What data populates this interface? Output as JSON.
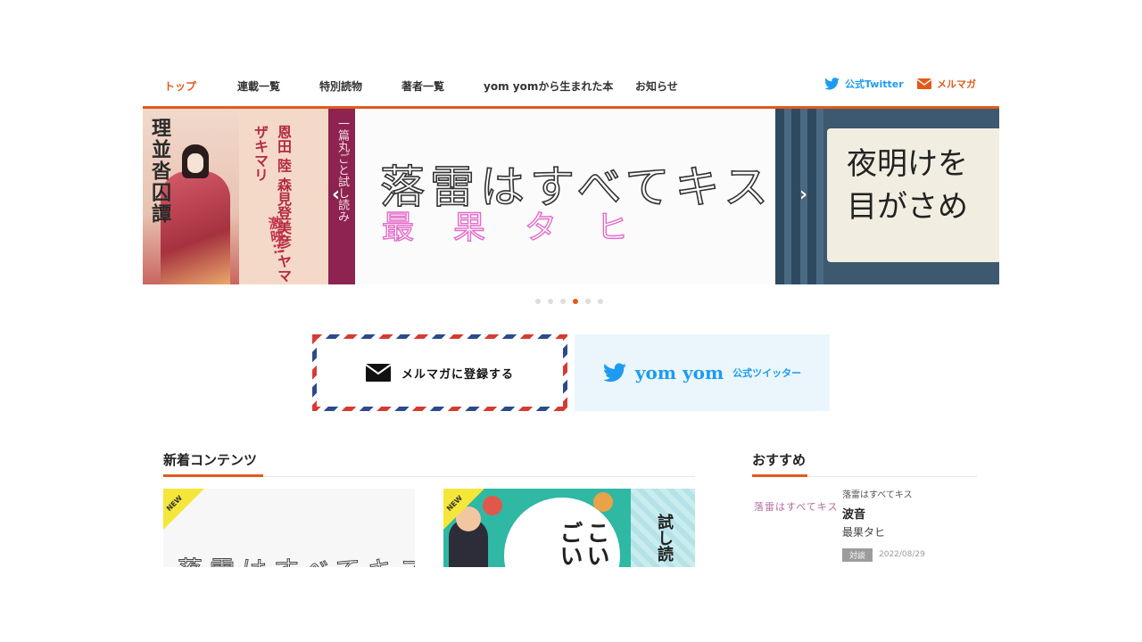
{
  "nav": {
    "items": [
      {
        "label": "トップ",
        "active": true
      },
      {
        "label": "連載一覧",
        "active": false
      },
      {
        "label": "特別読物",
        "active": false
      },
      {
        "label": "著者一覧",
        "active": false
      },
      {
        "label": "yom yomから生まれた本",
        "active": false
      },
      {
        "label": "お知らせ",
        "active": false
      }
    ],
    "twitter_label": "公式Twitter",
    "mailmag_label": "メルマガ"
  },
  "carousel": {
    "left_slide": {
      "title": "理並沓囚譚",
      "names": [
        "恩田 陸",
        "森見登美彦",
        "ヤマザキマリ"
      ],
      "tag": "激映!!",
      "band_text": "一篇丸ごと試し読み"
    },
    "main_slide": {
      "title": "落雷はすべてキス",
      "author": "最果タヒ"
    },
    "right_slide": {
      "line1": "夜明けを",
      "line2": "目がさめ"
    },
    "prev_arrow": "‹",
    "next_arrow": "›",
    "dot_count": 6,
    "active_dot": 4
  },
  "banners": {
    "mail_label": "メルマガに登録する",
    "twitter_brand": "yom yom",
    "twitter_sub": "公式ツイッター"
  },
  "new_contents": {
    "heading": "新着コンテンツ",
    "cards": [
      {
        "badge": "NEW",
        "image_text": "落雷はすべてキス"
      },
      {
        "badge": "NEW",
        "image_text": "こいごい",
        "side_text": "試し読"
      }
    ]
  },
  "recommended": {
    "heading": "おすすめ",
    "item": {
      "thumb_text": "落雷はすべてキス",
      "series": "落雷はすべてキス",
      "title": "波音",
      "author": "最果タヒ",
      "tag": "対談",
      "date": "2022/08/29"
    }
  },
  "colors": {
    "accent": "#e05a1c",
    "twitter": "#1d9bf0",
    "band": "#8d2350"
  }
}
